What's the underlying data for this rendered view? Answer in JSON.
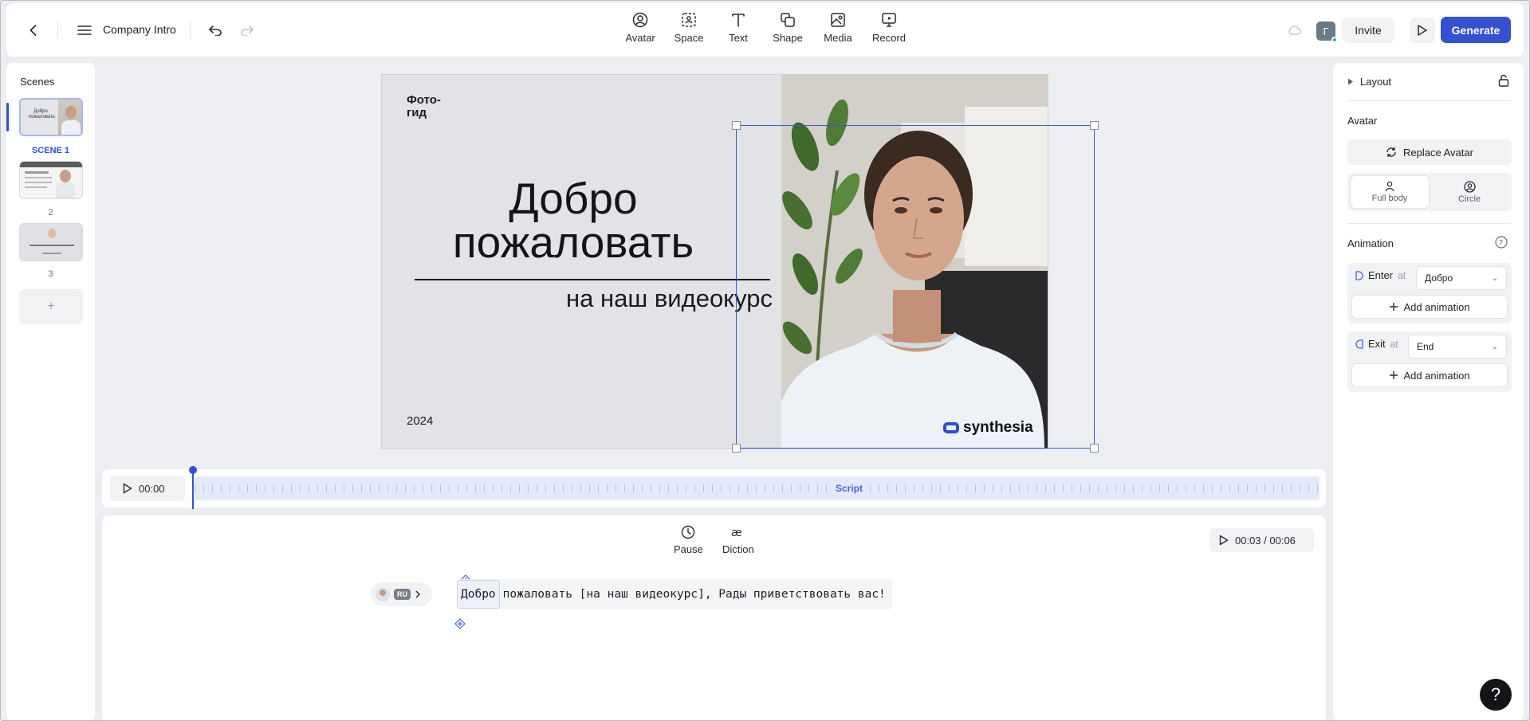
{
  "header": {
    "project_title": "Company Intro",
    "tools": [
      {
        "label": "Avatar",
        "icon": "avatar-icon"
      },
      {
        "label": "Space",
        "icon": "space-icon"
      },
      {
        "label": "Text",
        "icon": "text-icon"
      },
      {
        "label": "Shape",
        "icon": "shape-icon"
      },
      {
        "label": "Media",
        "icon": "media-icon"
      },
      {
        "label": "Record",
        "icon": "record-icon"
      }
    ],
    "user_initial": "Г",
    "invite_label": "Invite",
    "generate_label": "Generate",
    "accent_color": "#3451d1"
  },
  "scenes": {
    "title": "Scenes",
    "items": [
      {
        "label": "SCENE 1",
        "active": true
      },
      {
        "label": "2",
        "active": false
      },
      {
        "label": "3",
        "active": false
      }
    ],
    "add_label": "+"
  },
  "slide": {
    "brand": "Фото-\nгид",
    "heading": "Добро пожаловать",
    "subheading": "на наш видеокурс",
    "year": "2024",
    "logo_text": "synthesia"
  },
  "timeline": {
    "time": "00:00",
    "track_label": "Script"
  },
  "script": {
    "pause_label": "Pause",
    "diction_label": "Diction",
    "time_display": "00:03 / 00:06",
    "language_badge": "RU",
    "highlighted_word": "Добро",
    "line_rest": "пожаловать [на наш видеокурс], Рады приветствовать вас!"
  },
  "right_panel": {
    "layout_label": "Layout",
    "avatar_section": "Avatar",
    "replace_avatar_label": "Replace Avatar",
    "view_options": [
      {
        "label": "Full body",
        "active": true
      },
      {
        "label": "Circle",
        "active": false
      }
    ],
    "animation_section": "Animation",
    "enter": {
      "label": "Enter",
      "at": "at",
      "value": "Добро"
    },
    "exit": {
      "label": "Exit",
      "at": "at",
      "value": "End"
    },
    "add_animation_label": "Add animation"
  },
  "help_label": "?"
}
